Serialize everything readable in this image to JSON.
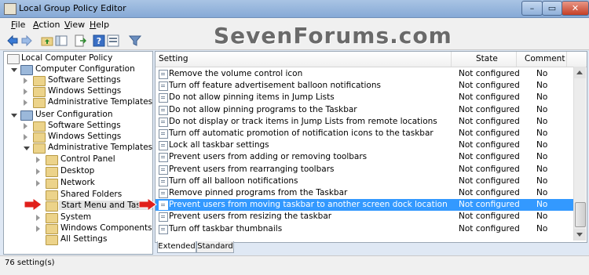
{
  "window": {
    "title": "Local Group Policy Editor",
    "close_glyph": "✕",
    "min_glyph": "–",
    "max_glyph": "▭"
  },
  "menu": [
    "File",
    "Action",
    "View",
    "Help"
  ],
  "watermark": "SevenForums.com",
  "tree": [
    {
      "label": "Local Computer Policy",
      "icon": "policy",
      "state": "none"
    },
    {
      "label": "Computer Configuration",
      "icon": "pc",
      "state": "open"
    },
    {
      "label": "Software Settings",
      "icon": "folder",
      "state": "closed"
    },
    {
      "label": "Windows Settings",
      "icon": "folder",
      "state": "closed"
    },
    {
      "label": "Administrative Templates",
      "icon": "folder",
      "state": "closed"
    },
    {
      "label": "User Configuration",
      "icon": "pc",
      "state": "open"
    },
    {
      "label": "Software Settings",
      "icon": "folder",
      "state": "closed"
    },
    {
      "label": "Windows Settings",
      "icon": "folder",
      "state": "closed"
    },
    {
      "label": "Administrative Templates",
      "icon": "folder",
      "state": "open"
    },
    {
      "label": "Control Panel",
      "icon": "folder",
      "state": "closed"
    },
    {
      "label": "Desktop",
      "icon": "folder",
      "state": "closed"
    },
    {
      "label": "Network",
      "icon": "folder",
      "state": "closed"
    },
    {
      "label": "Shared Folders",
      "icon": "folder",
      "state": "none"
    },
    {
      "label": "Start Menu and Taskbar",
      "icon": "folder",
      "state": "closed",
      "selected": true
    },
    {
      "label": "System",
      "icon": "folder",
      "state": "closed"
    },
    {
      "label": "Windows Components",
      "icon": "folder",
      "state": "closed"
    },
    {
      "label": "All Settings",
      "icon": "folder",
      "state": "none"
    }
  ],
  "list": {
    "headers": {
      "setting": "Setting",
      "state": "State",
      "comment": "Comment"
    },
    "rows": [
      {
        "name": "Remove the volume control icon",
        "state": "Not configured",
        "comment": "No"
      },
      {
        "name": "Turn off feature advertisement balloon notifications",
        "state": "Not configured",
        "comment": "No"
      },
      {
        "name": "Do not allow pinning items in Jump Lists",
        "state": "Not configured",
        "comment": "No"
      },
      {
        "name": "Do not allow pinning programs to the Taskbar",
        "state": "Not configured",
        "comment": "No"
      },
      {
        "name": "Do not display or track items in Jump Lists from remote locations",
        "state": "Not configured",
        "comment": "No"
      },
      {
        "name": "Turn off automatic promotion of notification icons to the taskbar",
        "state": "Not configured",
        "comment": "No"
      },
      {
        "name": "Lock all taskbar settings",
        "state": "Not configured",
        "comment": "No"
      },
      {
        "name": "Prevent users from adding or removing toolbars",
        "state": "Not configured",
        "comment": "No"
      },
      {
        "name": "Prevent users from rearranging toolbars",
        "state": "Not configured",
        "comment": "No"
      },
      {
        "name": "Turn off all balloon notifications",
        "state": "Not configured",
        "comment": "No"
      },
      {
        "name": "Remove pinned programs from the Taskbar",
        "state": "Not configured",
        "comment": "No"
      },
      {
        "name": "Prevent users from moving taskbar to another screen dock location",
        "state": "Not configured",
        "comment": "No",
        "selected": true
      },
      {
        "name": "Prevent users from resizing the taskbar",
        "state": "Not configured",
        "comment": "No"
      },
      {
        "name": "Turn off taskbar thumbnails",
        "state": "Not configured",
        "comment": "No"
      }
    ]
  },
  "tabs": [
    "Extended",
    "Standard"
  ],
  "status": "76 setting(s)",
  "colors": {
    "selection": "#3399ff",
    "arrow": "#e0201b"
  }
}
